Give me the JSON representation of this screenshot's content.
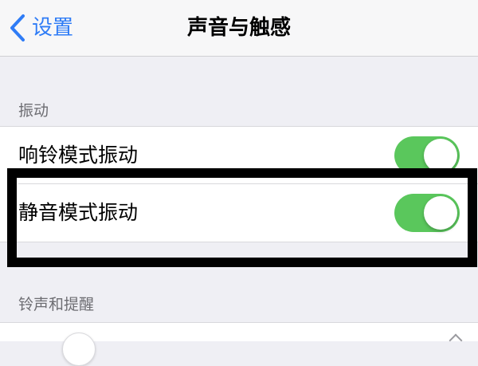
{
  "nav": {
    "back_label": "设置",
    "title": "声音与触感"
  },
  "sections": {
    "vibration": {
      "header": "振动",
      "rows": [
        {
          "label": "响铃模式振动",
          "toggle_on": true
        },
        {
          "label": "静音模式振动",
          "toggle_on": true
        }
      ]
    },
    "ringtone": {
      "header": "铃声和提醒"
    }
  },
  "colors": {
    "accent_blue": "#2f7cf6",
    "toggle_on_green": "#5ac75c",
    "background": "#efeff4",
    "highlight_border": "#000000"
  },
  "icons": {
    "back": "chevron-left-icon"
  }
}
